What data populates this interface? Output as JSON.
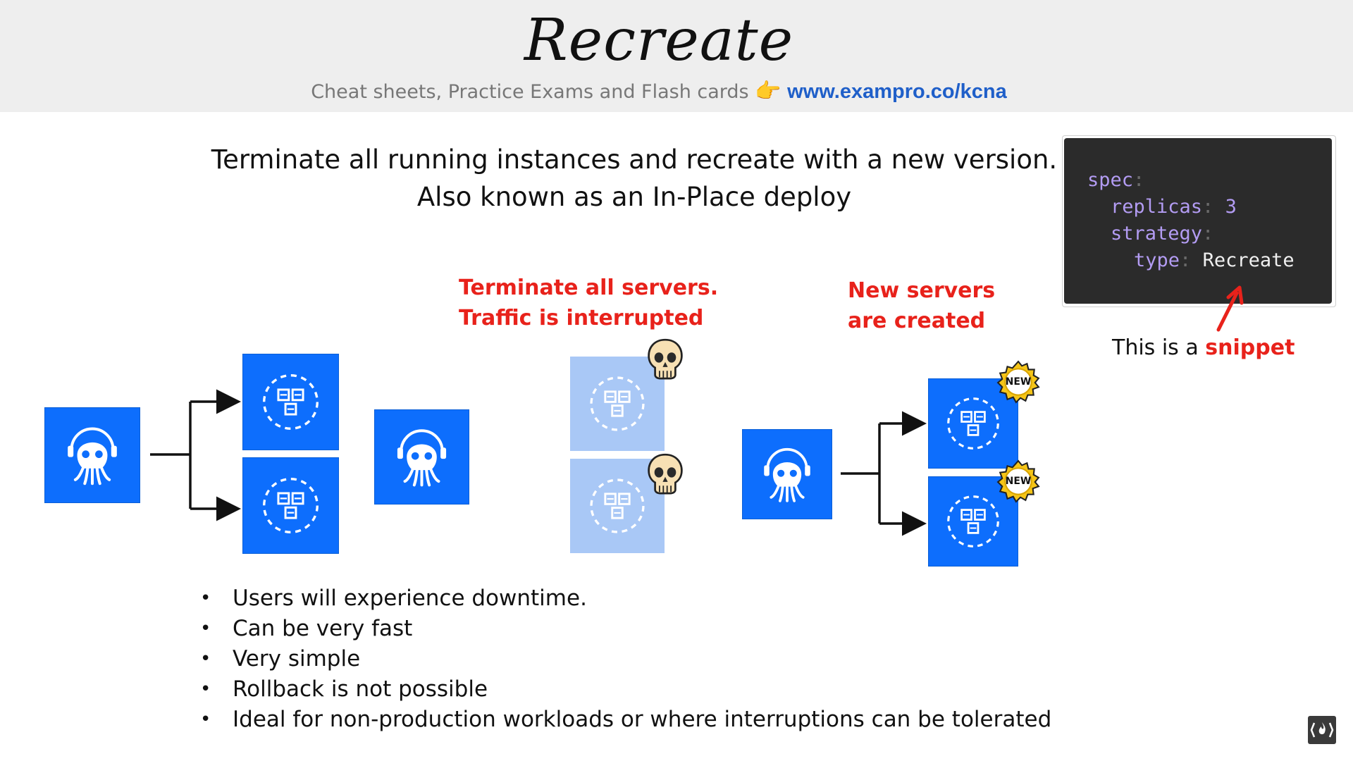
{
  "slide": {
    "title": "Recreate",
    "subtitle_text": "Cheat sheets, Practice Exams and Flash cards",
    "subtitle_pointer": "👉",
    "subtitle_link": "www.exampro.co/kcna",
    "headline_line1": "Terminate all running instances and recreate with a new version.",
    "headline_line2": "Also known as an In-Place deploy"
  },
  "labels": {
    "terminate_line1": "Terminate all servers.",
    "terminate_line2": "Traffic is interrupted",
    "new_line1": "New servers",
    "new_line2": "are created",
    "new_badge": "NEW"
  },
  "code": {
    "spec": "spec",
    "replicas": "replicas",
    "replicas_value": "3",
    "strategy": "strategy",
    "type": "type",
    "type_value": "Recreate",
    "colon": ":"
  },
  "snippet_note": {
    "prefix": "This is a",
    "highlight": "snippet"
  },
  "bullets": [
    "Users will experience downtime.",
    "Can be very fast",
    "Very simple",
    "Rollback is not possible",
    "Ideal for non-production workloads or where interruptions can be tolerated"
  ],
  "icons": {
    "octopus": "octopus-icon",
    "server": "server-icon",
    "skull": "skull-icon",
    "new_badge": "new-badge-icon",
    "arrow": "arrow-icon"
  },
  "colors": {
    "tile_blue": "#0d6efd",
    "tile_faded": "#a9c8f6",
    "alert_red": "#e8221b",
    "link_blue": "#1f5fc9",
    "code_bg": "#2b2b2b",
    "code_key": "#b39cf3"
  }
}
